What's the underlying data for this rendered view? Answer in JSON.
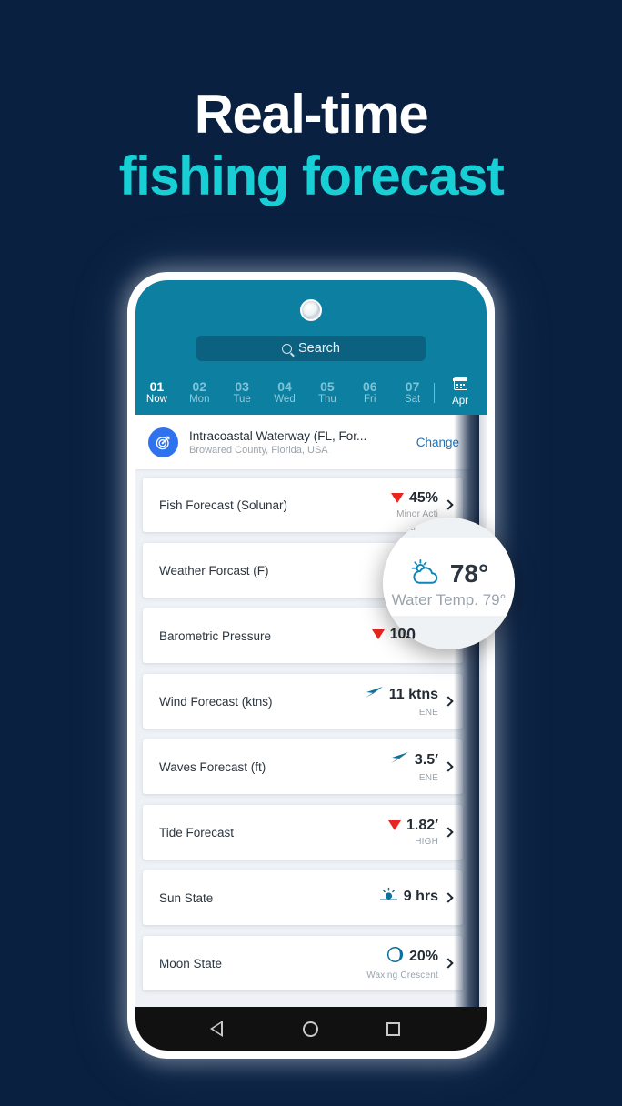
{
  "headline": {
    "line1": "Real-time",
    "line2": "fishing forecast",
    "color_line1": "#ffffff",
    "color_line2": "#18cfd6",
    "background": "#0a2040"
  },
  "phone": {
    "app_header": {
      "background": "#0d7fa0",
      "camera_icon": "front-camera",
      "search": {
        "icon": "search-icon",
        "placeholder": "Search",
        "value": ""
      },
      "dates": [
        {
          "num": "01",
          "name": "Now",
          "active": true
        },
        {
          "num": "02",
          "name": "Mon",
          "active": false
        },
        {
          "num": "03",
          "name": "Tue",
          "active": false
        },
        {
          "num": "04",
          "name": "Wed",
          "active": false
        },
        {
          "num": "05",
          "name": "Thu",
          "active": false
        },
        {
          "num": "06",
          "name": "Fri",
          "active": false
        },
        {
          "num": "07",
          "name": "Sat",
          "active": false
        }
      ],
      "month": {
        "icon": "calendar-icon",
        "label": "Apr"
      }
    },
    "location": {
      "icon": "target-location-icon",
      "icon_bg": "#2f72f0",
      "title": "Intracoastal Waterway (FL, For...",
      "subtitle": "Browared County, Florida, USA",
      "change_label": "Change",
      "change_color": "#2073b7"
    },
    "rows": [
      {
        "title": "Fish Forecast (Solunar)",
        "indicator": "down-triangle",
        "indicator_color": "#e8251f",
        "value": "45%",
        "sub": "Minor Acti",
        "chevron": "chevron-right-icon"
      },
      {
        "title": "Weather Forcast (F)",
        "indicator": "none",
        "indicator_color": "",
        "value": "",
        "sub": "Water",
        "chevron": "chevron-right-icon"
      },
      {
        "title": "Barometric Pressure",
        "indicator": "down-triangle",
        "indicator_color": "#e8251f",
        "value": "102590",
        "sub": "",
        "chevron": "chevron-right-icon"
      },
      {
        "title": "Wind Forecast (ktns)",
        "indicator": "wind-arrow-icon",
        "indicator_color": "#0d6f9c",
        "value": "11 ktns",
        "sub": "ENE",
        "chevron": "chevron-right-icon"
      },
      {
        "title": "Waves Forecast (ft)",
        "indicator": "wave-arrow-icon",
        "indicator_color": "#0d6f9c",
        "value": "3.5′",
        "sub": "ENE",
        "chevron": "chevron-right-icon"
      },
      {
        "title": "Tide Forecast",
        "indicator": "down-triangle",
        "indicator_color": "#e8251f",
        "value": "1.82′",
        "sub": "HIGH",
        "chevron": "chevron-right-icon"
      },
      {
        "title": "Sun State",
        "indicator": "sunrise-icon",
        "indicator_color": "#0d6f9c",
        "value": "9 hrs",
        "sub": "",
        "chevron": "chevron-right-icon"
      },
      {
        "title": "Moon State",
        "indicator": "moon-phase-icon",
        "indicator_color": "#0d6f9c",
        "value": "20%",
        "sub": "Waxing Crescent",
        "chevron": "chevron-right-icon"
      }
    ],
    "navbar": {
      "back": "back-triangle-icon",
      "home": "home-circle-icon",
      "recents": "recents-square-icon"
    }
  },
  "magnifier": {
    "weather_icon": "sun-behind-cloud-icon",
    "temperature": "78°",
    "water_temp": "Water Temp. 79°",
    "ghost_top": "nor Acti",
    "ghost_bottom": "2590"
  }
}
